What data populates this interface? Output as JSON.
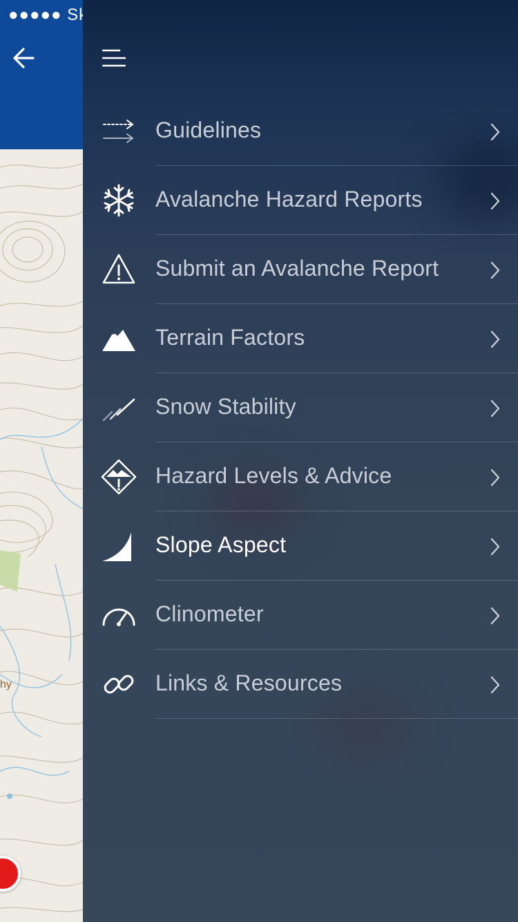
{
  "status_bar": {
    "signal": "●●●●●",
    "carrier": "Sk"
  },
  "map": {
    "place_label": "hy"
  },
  "menu": {
    "items": [
      {
        "label": "Guidelines",
        "icon": "guidelines-arrows-icon",
        "active": false
      },
      {
        "label": "Avalanche Hazard Reports",
        "icon": "snowflake-icon",
        "active": false
      },
      {
        "label": "Submit an Avalanche Report",
        "icon": "warning-triangle-icon",
        "active": false
      },
      {
        "label": "Terrain Factors",
        "icon": "mountain-icon",
        "active": false
      },
      {
        "label": "Snow Stability",
        "icon": "snow-stability-icon",
        "active": false
      },
      {
        "label": "Hazard Levels & Advice",
        "icon": "hazard-diamond-icon",
        "active": false
      },
      {
        "label": "Slope Aspect",
        "icon": "slope-icon",
        "active": true
      },
      {
        "label": "Clinometer",
        "icon": "gauge-icon",
        "active": false
      },
      {
        "label": "Links & Resources",
        "icon": "link-icon",
        "active": false
      }
    ]
  },
  "colors": {
    "header_blue": "#0f4a9a",
    "drawer_top": "#0e2546",
    "drawer_bottom": "#37475a",
    "menu_text": "#c9ced6",
    "active_text": "#ffffff",
    "pin_red": "#e31a1a"
  }
}
